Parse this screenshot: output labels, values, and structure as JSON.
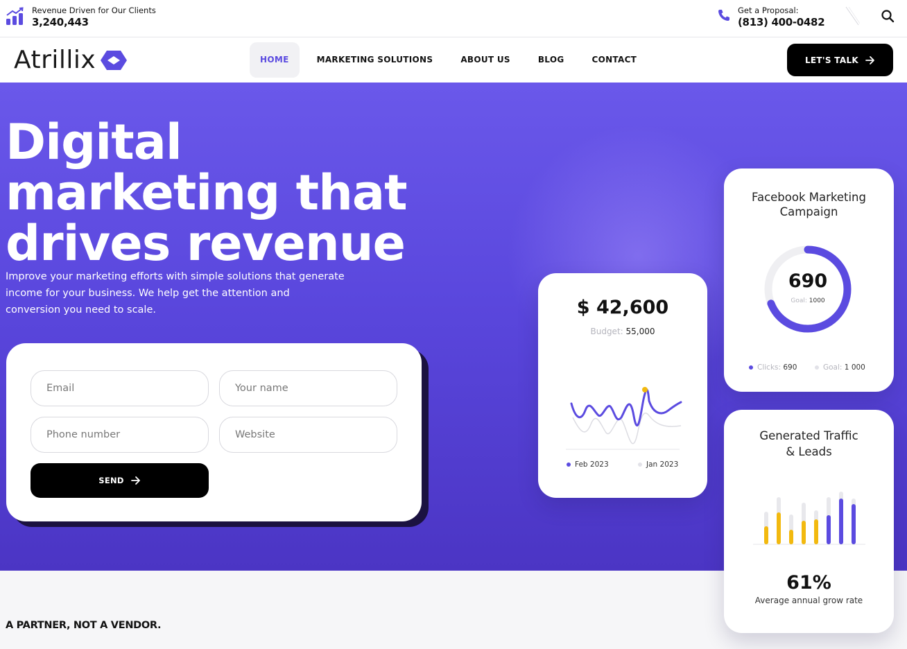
{
  "topbar": {
    "revenue_label": "Revenue Driven for Our Clients",
    "revenue_value": "3,240,443",
    "proposal_label": "Get a Proposal:",
    "proposal_phone": "(813) 400-0482",
    "icons": [
      "growth-chart-icon",
      "phone-icon",
      "search-icon"
    ]
  },
  "nav": {
    "logo_text": "Atrillix",
    "items": [
      "HOME",
      "MARKETING SOLUTIONS",
      "ABOUT US",
      "BLOG",
      "CONTACT"
    ],
    "active_index": 0,
    "cta_label": "LET'S TALK"
  },
  "hero": {
    "headline_1": "Digital",
    "headline_2": "marketing that",
    "headline_3": "drives revenue",
    "subtext": "Improve your marketing efforts with simple solutions that generate income for your business. We help get the attention and conversion you need to scale."
  },
  "form": {
    "email_placeholder": "Email",
    "name_placeholder": "Your name",
    "phone_placeholder": "Phone number",
    "website_placeholder": "Website",
    "send_label": "SEND"
  },
  "budget_card": {
    "amount": "$ 42,600",
    "budget_label": "Budget:",
    "budget_value": "55,000",
    "legend_1": "Feb 2023",
    "legend_2": "Jan 2023"
  },
  "facebook_card": {
    "title_1": "Facebook Marketing",
    "title_2": "Campaign",
    "value": "690",
    "goal_label": "Goal:",
    "goal_value": "1000",
    "clicks_label": "Clicks:",
    "clicks_value": "690",
    "legend_goal_label": "Goal:",
    "legend_goal_value": "1 000",
    "progress_fraction": 0.69
  },
  "traffic_card": {
    "title_1": "Generated Traffic",
    "title_2": "& Leads",
    "percent": "61%",
    "subtitle": "Average annual grow rate"
  },
  "section": {
    "partner_heading": "A PARTNER, NOT A VENDOR."
  },
  "colors": {
    "brand_purple": "#5b4be0",
    "hero_top": "#6a58ea",
    "hero_bottom": "#4b35c4",
    "accent_yellow": "#f2b90f",
    "bar_gray": "#e6e6ea"
  }
}
